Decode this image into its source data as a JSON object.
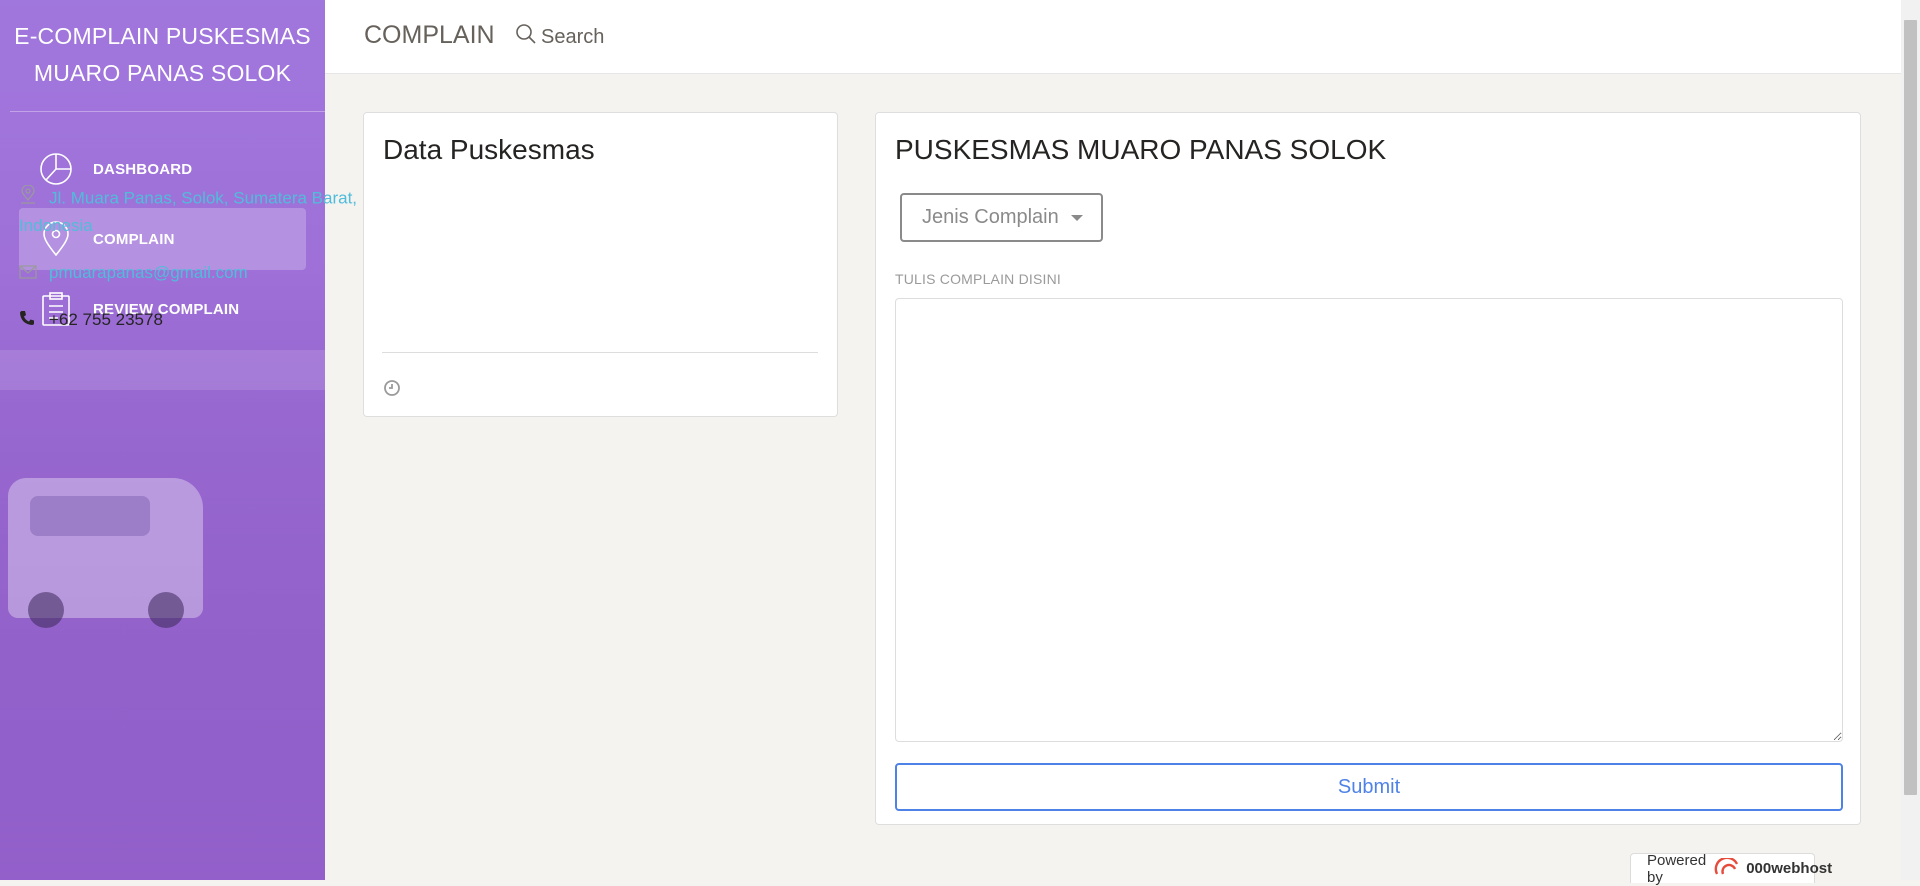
{
  "sidebar": {
    "brand_line1": "E-COMPLAIN PUSKESMAS",
    "brand_line2": "MUARO PANAS SOLOK",
    "items": [
      {
        "label": "DASHBOARD",
        "icon": "pie-chart-icon",
        "active": false
      },
      {
        "label": "COMPLAIN",
        "icon": "map-pin-icon",
        "active": true
      },
      {
        "label": "REVIEW COMPLAIN",
        "icon": "clipboard-icon",
        "active": false
      }
    ]
  },
  "topbar": {
    "title": "COMPLAIN",
    "search_label": "Search"
  },
  "info_card": {
    "title": "Data Puskesmas",
    "address": "Jl. Muara Panas, Solok, Sumatera Barat, Indonesia",
    "email": "pmuarapanas@gmail.com",
    "phone": "+62 755 23578"
  },
  "complain_card": {
    "title": "PUSKESMAS MUARO PANAS SOLOK",
    "dropdown_label": "Jenis Complain",
    "textarea_label": "TULIS COMPLAIN DISINI",
    "textarea_value": "",
    "submit_label": "Submit"
  },
  "footer": {
    "powered_by": "Powered by",
    "host": "000webhost"
  },
  "colors": {
    "accent_purple": "#9b6edc",
    "link_blue": "#51bcda",
    "submit_blue": "#4f82e6"
  }
}
